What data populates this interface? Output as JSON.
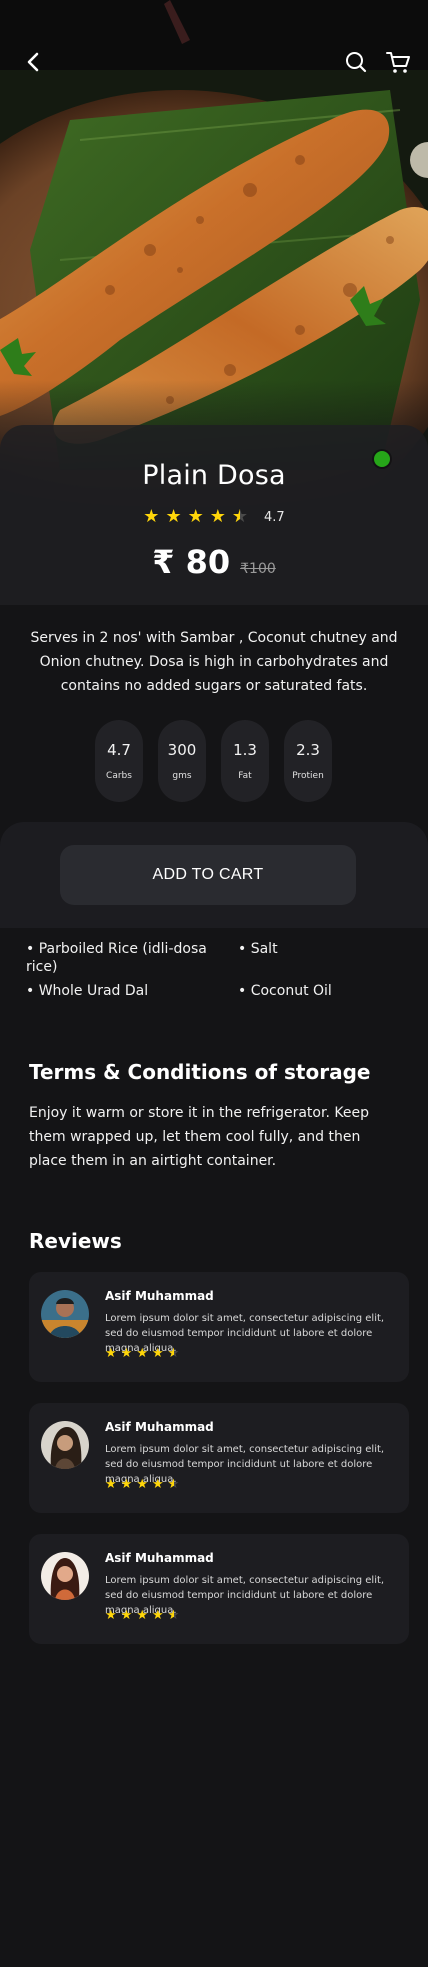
{
  "product": {
    "name": "Plain Dosa",
    "rating": "4.7",
    "stars": 4.5,
    "price": "₹ 80",
    "old_price": "₹100",
    "veg_color": "#26a619",
    "description": "Serves in 2 nos' with Sambar , Coconut chutney and Onion chutney. Dosa is high in carbohydrates and contains no added sugars or saturated fats."
  },
  "icons": {
    "back": "chevron-left-icon",
    "search": "search-icon",
    "cart": "cart-icon",
    "star": "star-icon"
  },
  "nutrition": [
    {
      "value": "4.7",
      "label": "Carbs"
    },
    {
      "value": "300",
      "label": "gms"
    },
    {
      "value": "1.3",
      "label": "Fat"
    },
    {
      "value": "2.3",
      "label": "Protien"
    }
  ],
  "cart": {
    "add_label": "ADD TO CART"
  },
  "ingredients": [
    "Parboiled Rice (idli-dosa rice)",
    "Salt",
    "Whole Urad Dal",
    "Coconut Oil"
  ],
  "terms": {
    "title": "Terms & Conditions of storage",
    "body": "Enjoy it warm or store it in the refrigerator. Keep them wrapped up, let them cool fully, and then place them in an airtight container."
  },
  "reviews": {
    "title": "Reviews",
    "items": [
      {
        "name": "Asif Muhammad",
        "text": "Lorem ipsum dolor sit amet, consectetur adipiscing elit, sed do eiusmod tempor incididunt ut labore et dolore magna aliqua.",
        "stars": 4.5
      },
      {
        "name": "Asif Muhammad",
        "text": "Lorem ipsum dolor sit amet, consectetur adipiscing elit, sed do eiusmod tempor incididunt ut labore et dolore magna aliqua.",
        "stars": 4.5
      },
      {
        "name": "Asif Muhammad",
        "text": "Lorem ipsum dolor sit amet, consectetur adipiscing elit, sed do eiusmod tempor incididunt ut labore et dolore magna aliqua.",
        "stars": 4.5
      }
    ]
  },
  "colors": {
    "accent_star": "#ffd60a",
    "background": "#141416",
    "card": "#1d1d21"
  }
}
